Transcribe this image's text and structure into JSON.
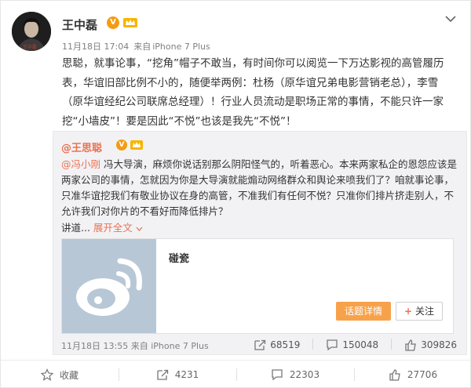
{
  "post": {
    "author": "王中磊",
    "time": "11月18日 17:04",
    "source_prefix": "来自",
    "source": "iPhone 7 Plus",
    "text": "思聪，就事论事，“挖角”帽子不敢当，有时间你可以阅览一下万达影视的高管履历表，华谊旧部比例不小的，随便举两例：杜杨（原华谊兄弟电影营销老总），李雪（原华谊经纪公司联席总经理）！行业人员流动是职场正常的事情，不能只许一家挖“小墙皮”！要是因此“不悦”也该是我先“不悦”！"
  },
  "repost": {
    "author": "@王思聪",
    "mention": "@冯小刚",
    "text": " 冯大导演，麻烦你说话别那么阴阳怪气的，听着恶心。本来两家私企的恩怨应该是两家公司的事情，怎就因为你是大导演就能煽动网络群众和舆论来喷我们了？咱就事论事，只准华谊挖我们有敬业协议在身的高管，不准我们有任何不悦？只准你们排片挤走别人，不允许我们对你片的不看好而降低排片？",
    "expand_prefix": "讲道...",
    "expand_link": "展开全文",
    "topic": {
      "title": "碰瓷",
      "detail_button": "话题详情",
      "follow_button": "关注"
    },
    "time": "11月18日 13:55",
    "source_prefix": "来自",
    "source": "iPhone 7 Plus",
    "stats": {
      "reposts": "68519",
      "comments": "150048",
      "likes": "309826"
    }
  },
  "actions": {
    "favorite": "收藏",
    "repost": "4231",
    "comment": "22303",
    "like": "27706"
  },
  "colors": {
    "accent": "#eb7350",
    "badge": "#f39c12",
    "topic_button": "#f7a24b"
  }
}
